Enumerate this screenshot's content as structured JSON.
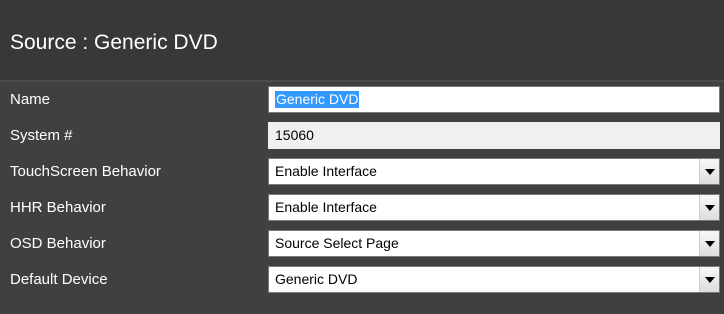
{
  "header": {
    "title": "Source : Generic DVD"
  },
  "fields": {
    "name": {
      "label": "Name",
      "value": "Generic DVD"
    },
    "system_number": {
      "label": "System #",
      "value": "15060"
    },
    "touchscreen_behavior": {
      "label": "TouchScreen Behavior",
      "value": "Enable Interface"
    },
    "hhr_behavior": {
      "label": "HHR Behavior",
      "value": "Enable Interface"
    },
    "osd_behavior": {
      "label": "OSD Behavior",
      "value": "Source Select Page"
    },
    "default_device": {
      "label": "Default Device",
      "value": "Generic DVD"
    }
  },
  "icons": {
    "dropdown": "chevron-down-icon"
  },
  "colors": {
    "panel_background": "#404040",
    "header_background": "#383838",
    "label_text": "#ffffff",
    "selection_highlight": "#3399ff"
  }
}
